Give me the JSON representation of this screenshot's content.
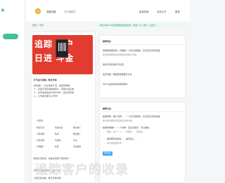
{
  "sidebar": {
    "logo": "网",
    "active_item": ""
  },
  "header": {
    "user_label": "我要加盟",
    "vip_label": "已开通模式",
    "links": [
      "信息查询",
      "业务大厅",
      "登录"
    ]
  },
  "breadcrumb": {
    "home": "首页",
    "sep": " > ",
    "current": "首页"
  },
  "notice": "每日3份1234条招聘数据免费发布，两种一点（两个）在线了",
  "banner": {
    "line1": "追踪 客户",
    "line2": "日进 斗金"
  },
  "left_panel": {
    "title": "扩写出卡系统 - 每日开单",
    "desc": [
      "微商推广：社交电商引流、品牌营销推",
      "广，获客引流获取精准客户，营销方案及推",
      "广，实现快速收益与稳步增长，提高商家收",
      "入，让你每天都可以开单！"
    ],
    "section_label": "大家用",
    "grid": [
      "微商引流",
      "营销方案",
      "微信推广",
      "口碑营销",
      "私域",
      "网络推广",
      "抖音营销",
      "新媒体",
      "外卖",
      "全网推广",
      "社群",
      "活动策划"
    ],
    "bottom": [
      "精准引流获客 · 快速找到属于你的客户",
      "免费引流获客软件 · 推广软件",
      "立即扫码领取 · 每日开单获客 ·"
    ]
  },
  "right_panel": {
    "section1_title": "推荐项目",
    "lines1": [
      "如果你想把复杂…并播放一个自己的网站，自己完全没有基础，",
      "建议你选择业务完成业务的执行方案…",
      "免费引流获客学习社区",
      "会员专属 · 精准获客课程与方法",
      "为什么是您尚未找到的客户"
    ],
    "section2_title": "推荐方法",
    "lines2": [
      "如果你想…推广运营……一个自己的网站，自己完全没有基础，",
      "建议你选择业务完成业务的方案。",
      "如果你想推广…一个简单，完全手把手…可以很快…",
      "……更好…这个一个……手把手……轻松的…",
      "……能够帮你自动化……提高收入……",
      "……本方案适合新手……"
    ],
    "more_button": "查看更多"
  },
  "watermark": "追踪客户的收录"
}
